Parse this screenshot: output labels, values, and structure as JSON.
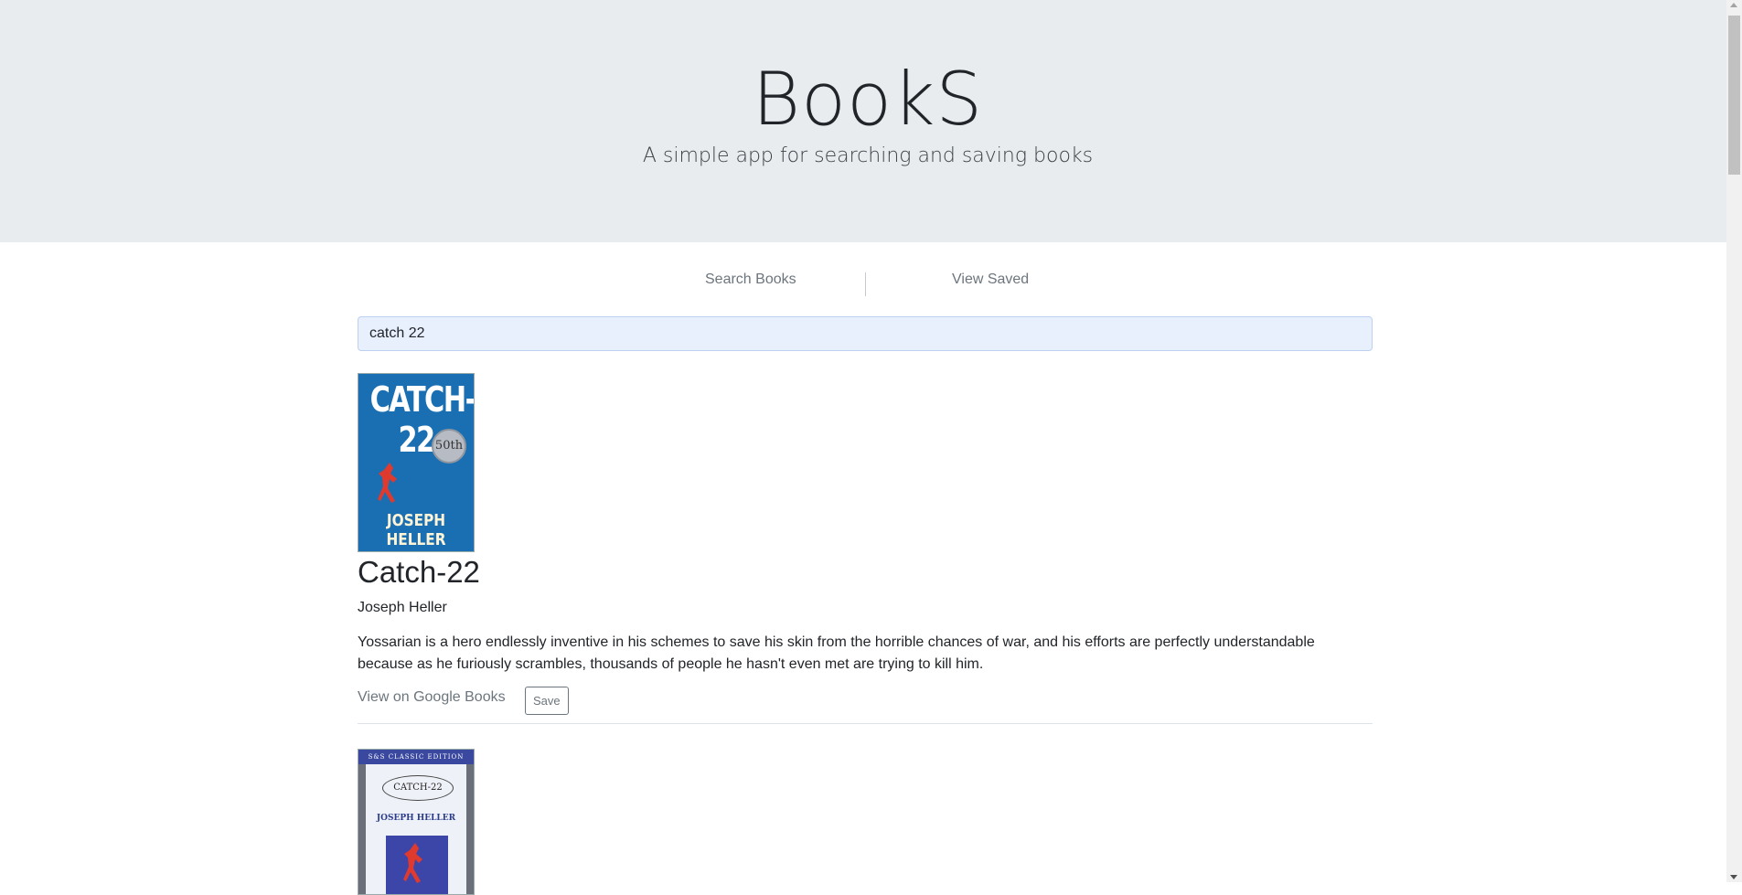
{
  "header": {
    "title": "BookS",
    "subtitle": "A simple app for searching and saving books"
  },
  "nav": {
    "search_label": "Search Books",
    "saved_label": "View Saved"
  },
  "search": {
    "value": "catch 22"
  },
  "results": [
    {
      "cover": {
        "title_text": "CATCH-22",
        "seal_text": "50th",
        "author_text": "JOSEPH HELLER"
      },
      "title": "Catch-22",
      "author": "Joseph Heller",
      "description": "Yossarian is a hero endlessly inventive in his schemes to save his skin from the horrible chances of war, and his efforts are perfectly understandable because as he furiously scrambles, thousands of people he hasn't even met are trying to kill him.",
      "link_label": "View on Google Books",
      "save_label": "Save"
    },
    {
      "cover": {
        "band_text": "S&S CLASSIC EDITION",
        "title_text": "CATCH-22",
        "author_text": "JOSEPH HELLER"
      }
    }
  ],
  "colors": {
    "jumbotron_bg": "#e9ecef",
    "input_bg": "#e8f0fe",
    "muted_text": "#6c757d"
  }
}
